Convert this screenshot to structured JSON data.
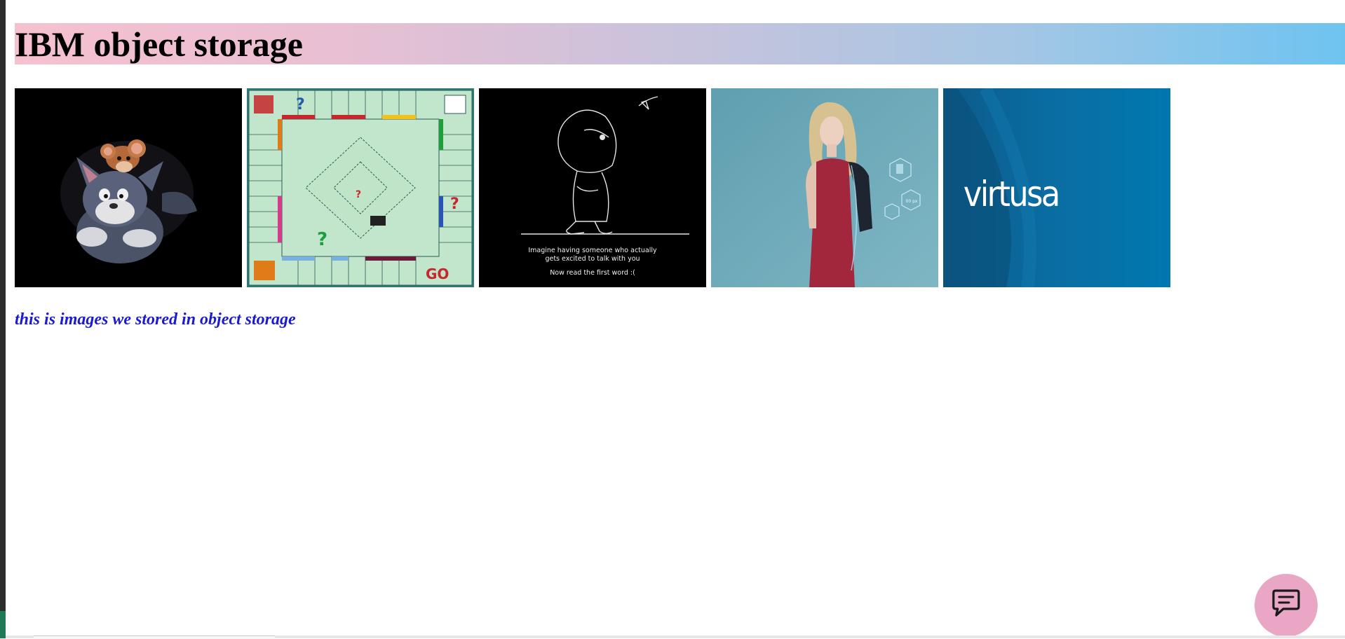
{
  "header": {
    "title": "IBM object storage"
  },
  "gallery": {
    "images": [
      {
        "name": "tom-and-jerry"
      },
      {
        "name": "monopoly-board"
      },
      {
        "name": "hooded-kid-drawing",
        "lines": [
          "Imagine having someone who actually",
          "gets excited to talk with you",
          "Now read the first word :("
        ]
      },
      {
        "name": "woman-tech-portrait",
        "badge": "00 px"
      },
      {
        "name": "virtusa-logo",
        "logo_text": "virtusa"
      }
    ]
  },
  "caption": {
    "text": "this is images we stored in object storage"
  },
  "chat": {
    "icon": "chat-bubble-icon",
    "color": "#eaa6c5"
  },
  "colors": {
    "caption": "#1a1ad0",
    "header_gradient_start": "#f6c1cf",
    "header_gradient_end": "#6ec4f0"
  }
}
